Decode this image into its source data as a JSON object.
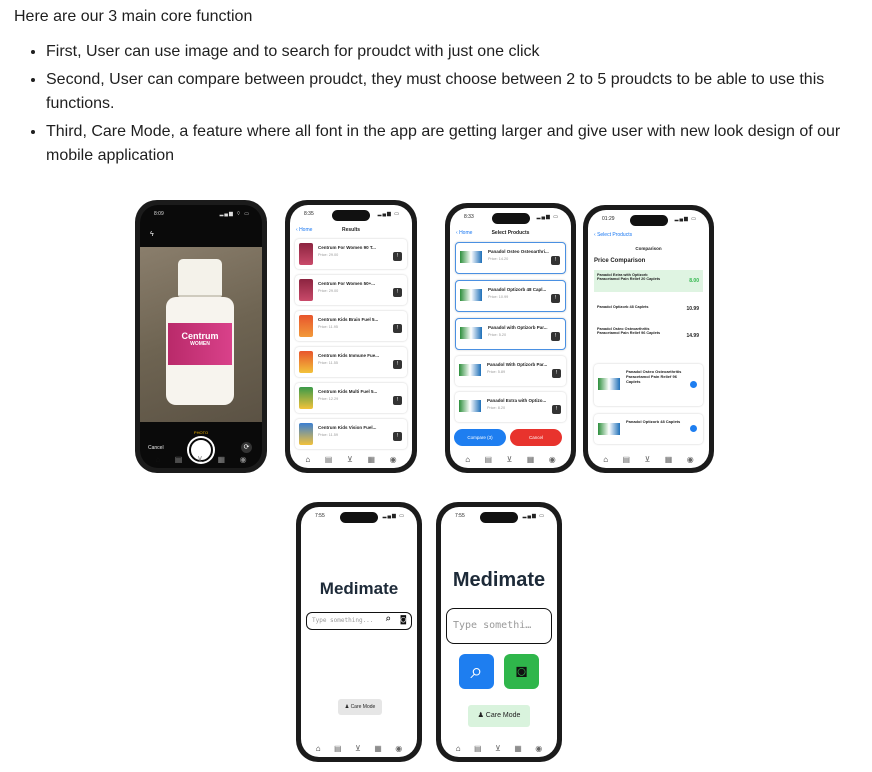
{
  "intro": "Here are our 3 main core function",
  "features": [
    "First, User can use image and to search for proudct with just one click",
    "Second, User can compare between proudct, they must choose between 2 to 5 proudcts to be able to use this functions.",
    "Third, Care Mode, a feature where all font in the app are getting larger and give user with new look design of our mobile application"
  ],
  "phone1": {
    "time": "8:09",
    "photo_label": "PHOTO",
    "cancel": "Cancel",
    "bottle_brand": "Centrum",
    "bottle_sub": "WOMEN"
  },
  "phone2": {
    "time": "8:35",
    "back": "Home",
    "title": "Results",
    "items": [
      {
        "name": "Centrum For Women 90 T...",
        "price": "Price: 29.00"
      },
      {
        "name": "Centrum For Women 50+...",
        "price": "Price: 29.00"
      },
      {
        "name": "Centrum Kids Brain Fuel 5...",
        "price": "Price: 11.95"
      },
      {
        "name": "Centrum Kids Immune Fue...",
        "price": "Price: 11.55"
      },
      {
        "name": "Centrum Kids Multi Fuel 5...",
        "price": "Price: 12.29"
      },
      {
        "name": "Centrum Kids Vision Fuel...",
        "price": "Price: 11.59"
      }
    ]
  },
  "phone3": {
    "time": "8:33",
    "back": "Home",
    "title": "Select Products",
    "items": [
      {
        "name": "Panadol Osteo Osteoarthri...",
        "price": "Price: 14.20"
      },
      {
        "name": "Panadol Optizorb 48 Capl...",
        "price": "Price: 10.99"
      },
      {
        "name": "Panadol with Optizorb Par...",
        "price": "Price: 5.20"
      },
      {
        "name": "Panadol With Optizorb Par...",
        "price": "Price: 5.89"
      },
      {
        "name": "Panadol Extra with Optizo...",
        "price": "Price: 8.20"
      }
    ],
    "compare": "Compare (3)",
    "cancel": "Cancel"
  },
  "phone4": {
    "time": "01:29",
    "back": "Select Products",
    "title": "Comparison",
    "heading": "Price Comparison",
    "rows": [
      {
        "name": "Panadol Extra with Optizorb Paracetamol Pain Relief 20 Caplets",
        "value": "8.00"
      },
      {
        "name": "Panadol Optizorb 48 Caplets",
        "value": "10.99"
      },
      {
        "name": "Panadol Osteo Osteoarthritis Paracetamol Pain Relief 96 Caplets",
        "value": "14.99"
      }
    ],
    "cards": [
      {
        "name": "Panadol Osteo Osteoarthritis Paracetamol Pain Relief 96 Caplets"
      },
      {
        "name": "Panadol Optizorb 48 Caplets"
      }
    ]
  },
  "phone5": {
    "time": "7:55",
    "title": "Medimate",
    "placeholder": "Type something...",
    "care": "Care Mode"
  },
  "phone6": {
    "time": "7:55",
    "title": "Medimate",
    "placeholder": "Type somethi…",
    "care": "Care Mode"
  },
  "colors": {
    "accent": "#1e7ef0",
    "cancel": "#e8332d",
    "green": "#2fb64b",
    "care_bg": "#d9f3dd"
  }
}
